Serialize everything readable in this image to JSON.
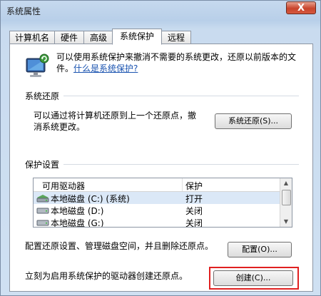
{
  "window": {
    "title": "系统属性",
    "close_glyph": "X"
  },
  "tabs": [
    {
      "label": "计算机名"
    },
    {
      "label": "硬件"
    },
    {
      "label": "高级"
    },
    {
      "label": "系统保护"
    },
    {
      "label": "远程"
    }
  ],
  "intro": {
    "text": "可以使用系统保护来撤消不需要的系统更改，还原以前版本的文件。",
    "link": "什么是系统保护?"
  },
  "restore": {
    "section_title": "系统还原",
    "description": "可以通过将计算机还原到上一个还原点，撤消系统更改。",
    "button_label": "系统还原(S)..."
  },
  "protection": {
    "section_title": "保护设置",
    "columns": {
      "drive": "可用驱动器",
      "protection": "保护"
    },
    "rows": [
      {
        "drive": "本地磁盘 (C:) (系统)",
        "status": "打开"
      },
      {
        "drive": "本地磁盘 (D:)",
        "status": "关闭"
      },
      {
        "drive": "本地磁盘 (G:)",
        "status": "关闭"
      }
    ],
    "configure_text": "配置还原设置、管理磁盘空间，并且删除还原点。",
    "configure_button": "配置(O)...",
    "create_text": "立刻为启用系统保护的驱动器创建还原点。",
    "create_button": "创建(C)..."
  },
  "colors": {
    "highlight": "#e02020",
    "link": "#1a53b0"
  }
}
